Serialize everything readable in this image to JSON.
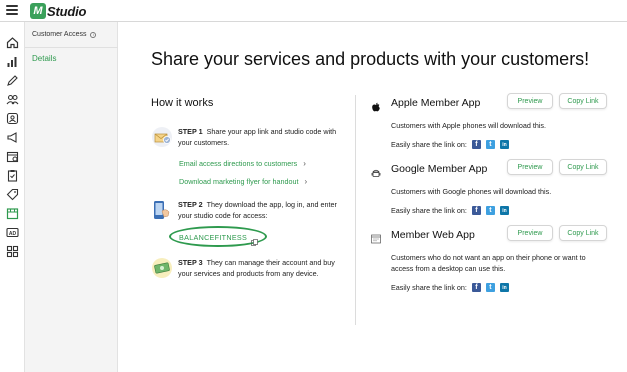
{
  "header": {
    "logo_text": "Studio",
    "logo_mark": "M"
  },
  "rail": {
    "icons": [
      "home-icon",
      "analytics-icon",
      "pencil-icon",
      "clients-icon",
      "staff-icon",
      "megaphone-icon",
      "calendar-icon",
      "clipboard-icon",
      "tag-icon",
      "store-icon",
      "ad-icon",
      "apps-icon"
    ],
    "active": "store-icon",
    "accent": "#2e9a4e"
  },
  "subnav": {
    "title": "Customer Access",
    "items": [
      {
        "label": "Details"
      }
    ]
  },
  "main": {
    "title": "Share your services and products with your customers!",
    "how_it_works": {
      "heading": "How it works",
      "steps": [
        {
          "label": "STEP 1",
          "text": "Share your app link and studio code with your customers."
        },
        {
          "label": "STEP 2",
          "text": "They download the app, log in, and enter your studio code for access:"
        },
        {
          "label": "STEP 3",
          "text": "They can manage their account and buy your services and products from any device."
        }
      ],
      "links": [
        {
          "label": "Email access directions to customers"
        },
        {
          "label": "Download marketing flyer for handout"
        }
      ],
      "studio_code": "BALANCEFITNESS"
    },
    "apps": [
      {
        "icon": "apple-icon",
        "title": "Apple Member App",
        "preview_label": "Preview",
        "copy_label": "Copy Link",
        "description": "Customers with Apple phones will download this.",
        "share_label": "Easily share the link on:"
      },
      {
        "icon": "android-icon",
        "title": "Google Member App",
        "preview_label": "Preview",
        "copy_label": "Copy Link",
        "description": "Customers with Google phones will download this.",
        "share_label": "Easily share the link on:"
      },
      {
        "icon": "browser-icon",
        "title": "Member Web App",
        "preview_label": "Preview",
        "copy_label": "Copy Link",
        "description": "Customers who do not want an app on their phone or want to access from a desktop can use this.",
        "share_label": "Easily share the link on:"
      }
    ],
    "social": {
      "facebook_glyph": "f",
      "twitter_glyph": "t",
      "linkedin_glyph": "in"
    }
  }
}
